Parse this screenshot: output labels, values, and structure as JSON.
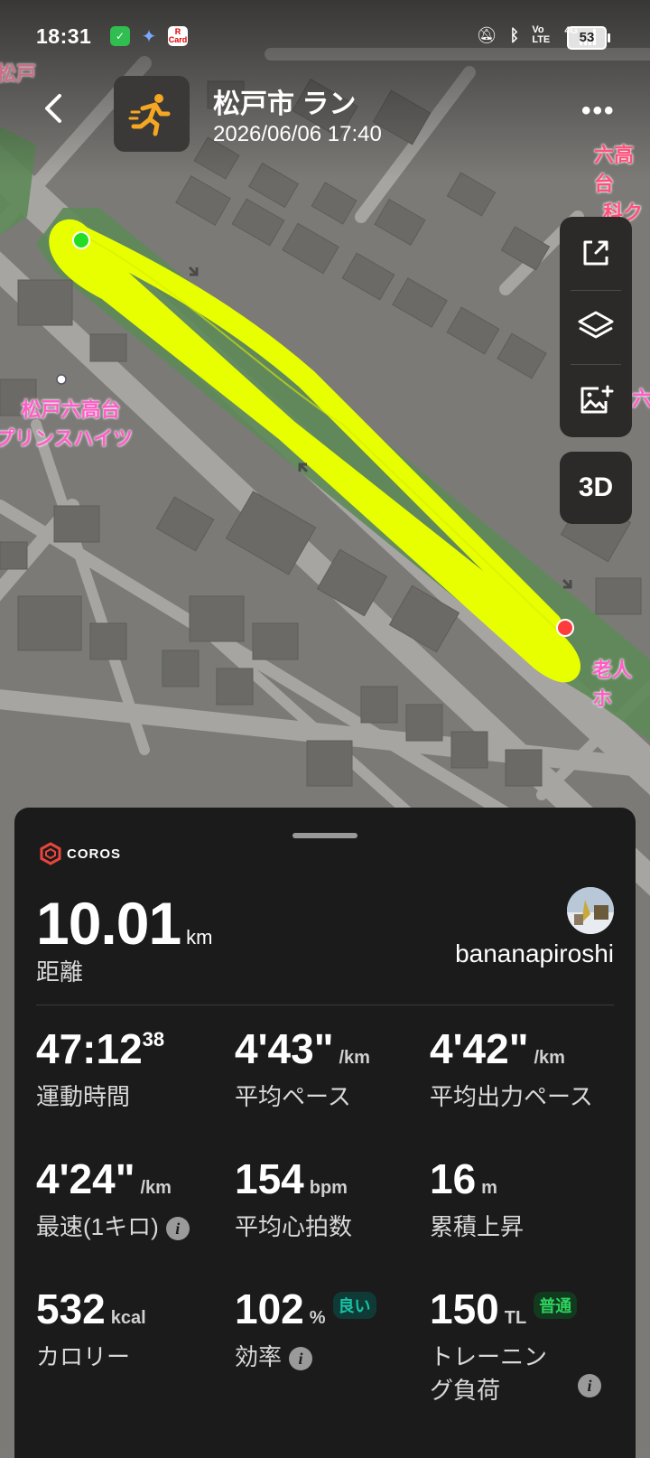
{
  "status_bar": {
    "time": "18:31",
    "battery": "53",
    "network_label": "4G",
    "volte_label": "Vo LTE",
    "app_badge_label": "R Card"
  },
  "header": {
    "title": "松戸市 ラン",
    "datetime": "2026/06/06 17:40",
    "back_icon": "chevron-left",
    "more_icon": "more-horizontal",
    "activity_icon": "running",
    "accent": "#f5a623"
  },
  "map": {
    "labels": {
      "place_1_line1": "松戸六高台",
      "place_1_line2": "プリンスハイツ",
      "place_2_line1": "六高台",
      "place_2_line2": "科ク",
      "place_3": "老人ホ",
      "place_4": "松戸",
      "place_5": "六"
    },
    "route_color": "#e8ff00",
    "start_color": "#22dd22",
    "end_color": "#ff3b3b"
  },
  "tools": {
    "share_icon": "share",
    "layers_icon": "layers",
    "add_image_icon": "image-add",
    "btn_3d_label": "3D"
  },
  "panel": {
    "brand": "COROS",
    "distance": {
      "value": "10.01",
      "unit": "km",
      "label": "距離"
    },
    "username": "bananapiroshi",
    "stats": [
      {
        "main": "47:12",
        "sup": "38",
        "unit": "",
        "label": "運動時間"
      },
      {
        "main": "4'43\"",
        "unit": "/km",
        "label": "平均ペース"
      },
      {
        "main": "4'42\"",
        "unit": "/km",
        "label": "平均出力ペース"
      },
      {
        "main": "4'24\"",
        "unit": "/km",
        "label": "最速(1キロ)"
      },
      {
        "main": "154",
        "unit": "bpm",
        "label": "平均心拍数"
      },
      {
        "main": "16",
        "unit": "m",
        "label": "累積上昇"
      },
      {
        "main": "532",
        "unit": "kcal",
        "label": "カロリー"
      },
      {
        "main": "102",
        "unit": "%",
        "badge": "良い",
        "label": "効率"
      },
      {
        "main": "150",
        "unit": "TL",
        "badge": "普通",
        "label": "トレーニン",
        "label_line2": "グ負荷"
      }
    ],
    "badge_colors": {
      "good": "#16c2a5",
      "normal": "#2ed15e"
    }
  }
}
